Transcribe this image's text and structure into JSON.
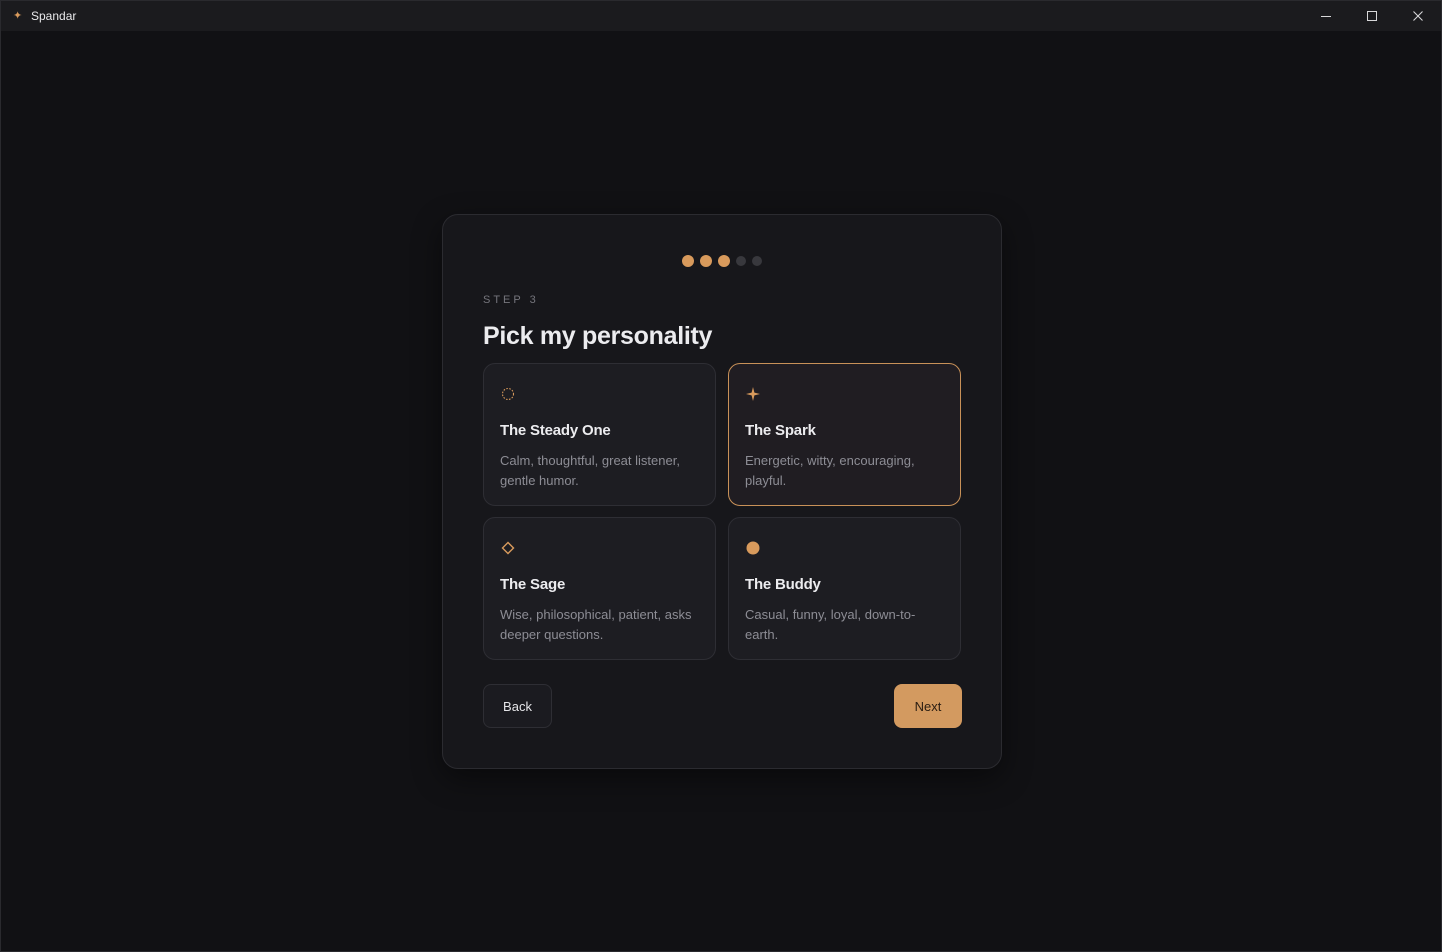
{
  "window": {
    "title": "Spandar",
    "app_icon": "sparkle-icon",
    "controls": [
      "minimize-icon",
      "maximize-icon",
      "close-icon"
    ]
  },
  "wizard": {
    "progress": {
      "total_steps": 5,
      "completed_steps": 3
    },
    "step_label": "STEP 3",
    "heading": "Pick my personality",
    "options": [
      {
        "icon": "dashed-circle-icon",
        "title": "The Steady One",
        "description": "Calm, thoughtful, great listener, gentle humor.",
        "selected": false
      },
      {
        "icon": "four-point-star-icon",
        "title": "The Spark",
        "description": "Energetic, witty, encouraging, playful.",
        "selected": true
      },
      {
        "icon": "diamond-outline-icon",
        "title": "The Sage",
        "description": "Wise, philosophical, patient, asks deeper questions.",
        "selected": false
      },
      {
        "icon": "filled-circle-icon",
        "title": "The Buddy",
        "description": "Casual, funny, loyal, down-to-earth.",
        "selected": false
      }
    ],
    "back_label": "Back",
    "next_label": "Next"
  },
  "colors": {
    "accent": "#d89a5c",
    "background": "#111114",
    "card": "#17171b",
    "option_bg": "#1d1d22"
  }
}
